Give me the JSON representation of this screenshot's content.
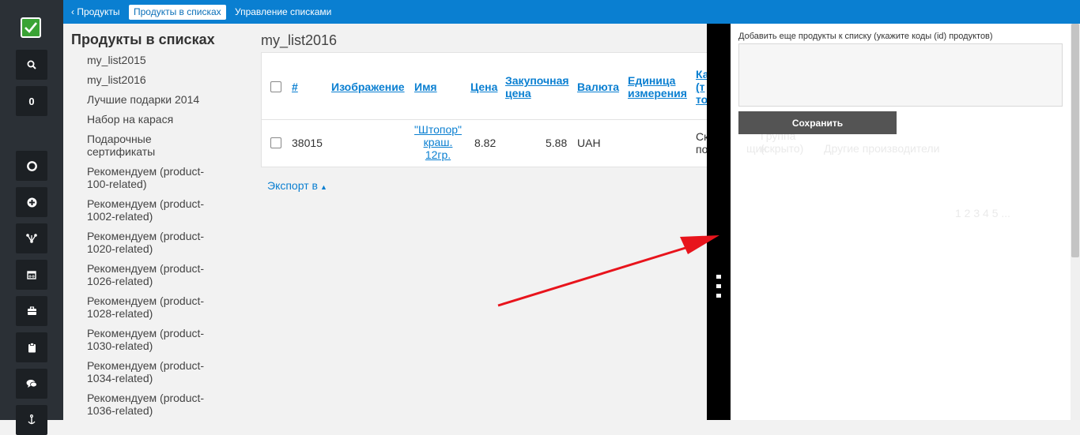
{
  "nav": {
    "back": "‹ Продукты",
    "current": "Продукты в списках",
    "manage": "Управление списками"
  },
  "rail": {
    "count": "0"
  },
  "sidebar": {
    "title": "Продукты в списках",
    "items": [
      "my_list2015",
      "my_list2016",
      "Лучшие подарки 2014",
      "Набор на карася",
      "Подарочные сертификаты",
      "Рекомендуем (product-100-related)",
      "Рекомендуем (product-1002-related)",
      "Рекомендуем (product-1020-related)",
      "Рекомендуем (product-1026-related)",
      "Рекомендуем (product-1028-related)",
      "Рекомендуем (product-1030-related)",
      "Рекомендуем (product-1034-related)",
      "Рекомендуем (product-1036-related)"
    ]
  },
  "main": {
    "list_title": "my_list2016",
    "columns": {
      "id": "#",
      "image": "Изображение",
      "name": "Имя",
      "price": "Цена",
      "purchase_price_1": "Закупочная",
      "purchase_price_2": "цена",
      "currency": "Валюта",
      "unit_1": "Единица",
      "unit_2": "измерения",
      "cat_1": "Ка",
      "cat_2": "(т",
      "cat_3": "то"
    },
    "rows": [
      {
        "id": "38015",
        "name_1": "\"Штопор\"",
        "name_2": "краш.",
        "name_3": "12гр.",
        "price": "8.82",
        "purchase_price": "5.88",
        "currency": "UAH",
        "cat_1": "Ск",
        "cat_2": "по"
      }
    ],
    "export": "Экспорт в"
  },
  "panel": {
    "add_label": "Добавить еще продукты к списку (укажите коды (id) продуктов)",
    "textarea_value": "",
    "save": "Сохранить"
  },
  "ghost": {
    "line1": "щик",
    "line2a": "Группа",
    "line2b": "(скрыто)",
    "line3": "Другие производители",
    "pages": "1  2  3  4  5 ..."
  },
  "colors": {
    "topbar": "#0a7fd1",
    "rail": "#2b3036",
    "accent_link": "#0a7fd1",
    "save_button": "#545454",
    "arrow": "#e8141c"
  }
}
